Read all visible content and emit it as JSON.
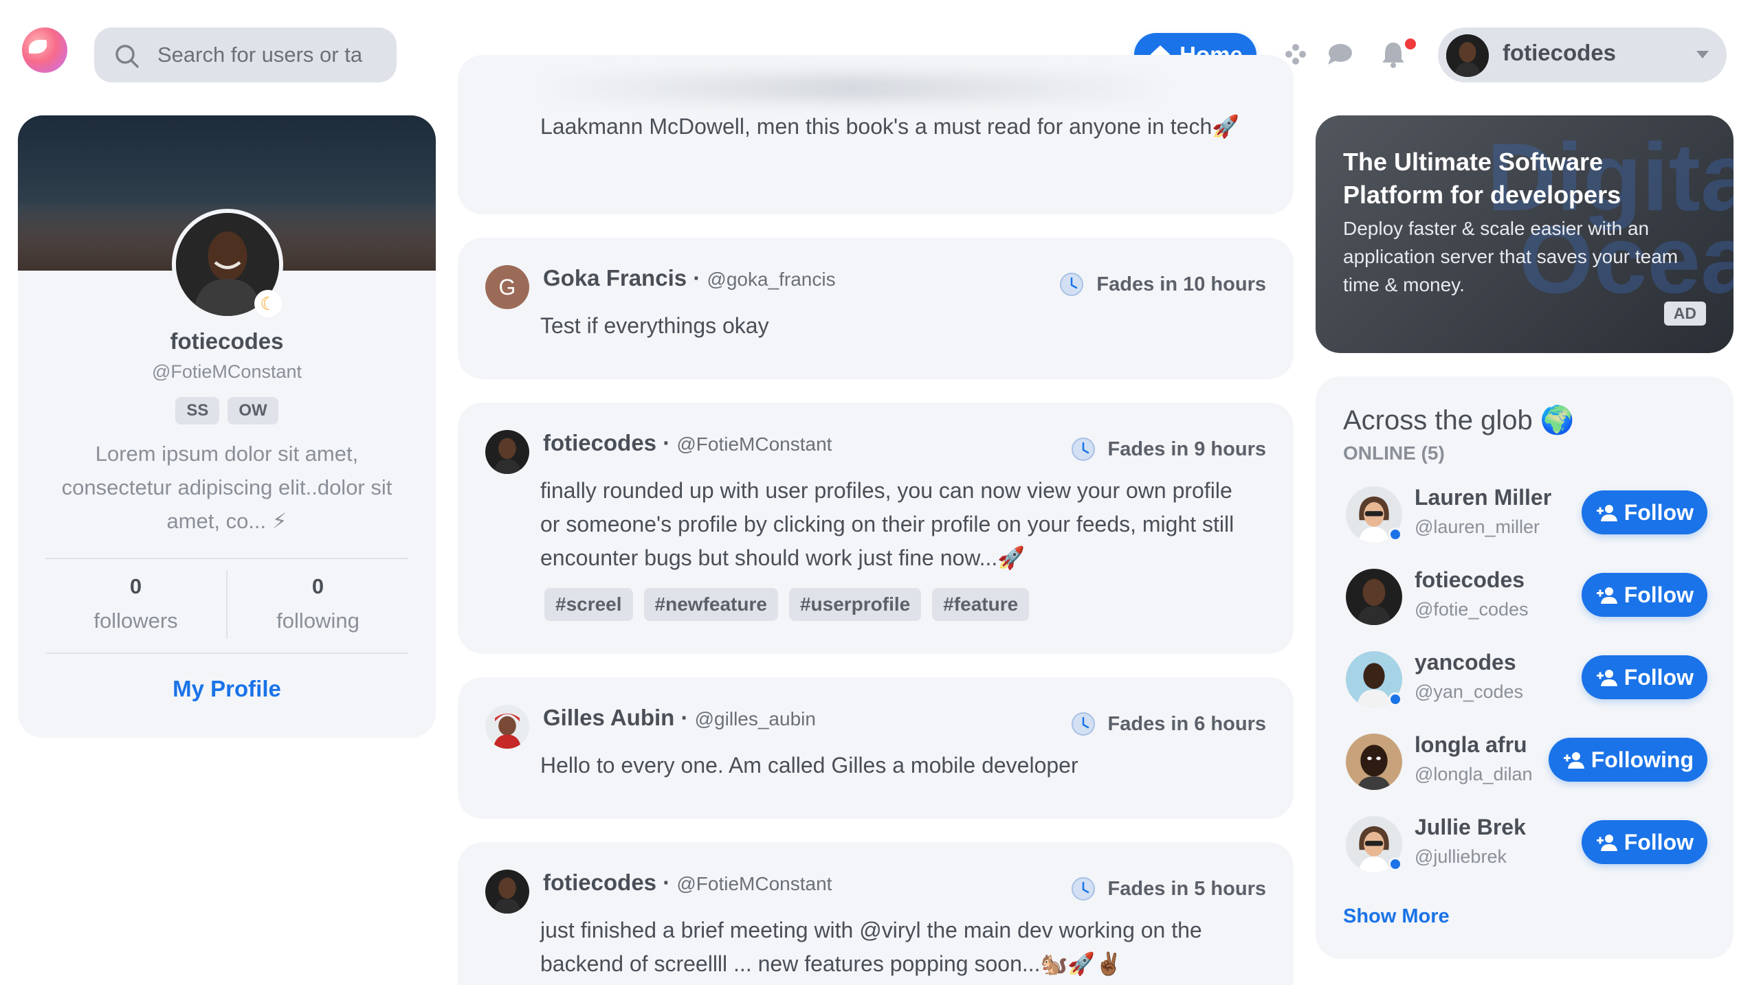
{
  "header": {
    "search_placeholder": "Search for users or ta",
    "home_label": "Home",
    "user_name": "fotiecodes"
  },
  "profile": {
    "name": "fotiecodes",
    "handle": "@FotieMConstant",
    "tags": [
      "SS",
      "OW"
    ],
    "bio": "Lorem ipsum dolor sit amet, consectetur adipiscing elit..dolor sit amet, co... ⚡",
    "followers_count": "0",
    "followers_label": "followers",
    "following_count": "0",
    "following_label": "following",
    "my_profile_label": "My Profile"
  },
  "feed": {
    "partial_post": {
      "body": "Laakmann McDowell, men this book's a must read for anyone in tech🚀"
    },
    "posts": [
      {
        "author": "Goka Francis",
        "handle": "@goka_francis",
        "avatar_letter": "G",
        "fades": "Fades in 10 hours",
        "body": "Test if everythings okay",
        "tags": []
      },
      {
        "author": "fotiecodes",
        "handle": "@FotieMConstant",
        "fades": "Fades in 9 hours",
        "body": "finally rounded up with user profiles, you can now view your own profile or someone's profile by clicking on their profile on your feeds, might still encounter bugs but should work just fine now...🚀",
        "tags": [
          "#screel",
          "#newfeature",
          "#userprofile",
          "#feature"
        ]
      },
      {
        "author": "Gilles Aubin",
        "handle": "@gilles_aubin",
        "fades": "Fades in 6 hours",
        "body": "Hello to every one. Am called Gilles a mobile developer",
        "tags": []
      },
      {
        "author": "fotiecodes",
        "handle": "@FotieMConstant",
        "fades": "Fades in 5 hours",
        "body": "just finished a brief meeting with @viryl the main dev working on the backend of screellll ... new features popping soon...🐿️🚀✌🏾",
        "tags": []
      }
    ]
  },
  "ad": {
    "title": "The Ultimate Software Platform for developers",
    "text": "Deploy faster & scale easier with an application server that saves your team time & money.",
    "badge": "AD",
    "watermark": "Digita Ocea"
  },
  "online": {
    "title": "Across the glob 🌍",
    "subtitle": "ONLINE (5)",
    "users": [
      {
        "name": "Lauren Miller",
        "handle": "@lauren_miller",
        "button": "Follow",
        "online": true
      },
      {
        "name": "fotiecodes",
        "handle": "@fotie_codes",
        "button": "Follow",
        "online": false
      },
      {
        "name": "yancodes",
        "handle": "@yan_codes",
        "button": "Follow",
        "online": true
      },
      {
        "name": "longla afru",
        "handle": "@longla_dilan",
        "button": "Following",
        "online": false
      },
      {
        "name": "Jullie Brek",
        "handle": "@julliebrek",
        "button": "Follow",
        "online": true
      }
    ],
    "show_more": "Show More"
  },
  "colors": {
    "accent": "#1a73e8",
    "card_bg": "#f3f5f8",
    "notification": "#ef3b3b"
  },
  "icons": [
    "search-icon",
    "home-icon",
    "apps-icon",
    "chat-icon",
    "bell-icon",
    "clock-icon",
    "add-user-icon",
    "chevron-down-icon",
    "moon-icon"
  ]
}
